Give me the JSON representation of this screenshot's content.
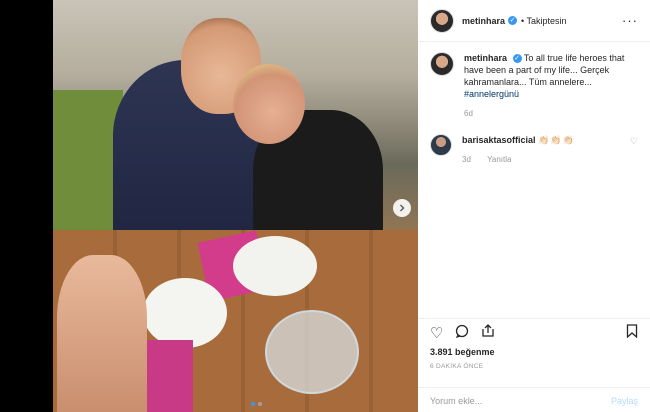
{
  "post": {
    "username": "metinhara",
    "follow_status": "• Takiptesin",
    "caption_user": "metinhara",
    "caption_text": "To all true life heroes that have been a part of my life... Gerçek kahramanlara... Tüm annelere...",
    "caption_hashtag": "#annelergünü",
    "caption_age": "6d"
  },
  "comments": [
    {
      "user": "barisaktasofficial",
      "text": "👏🏻👏🏻👏🏻",
      "age": "3d",
      "reply_label": "Yanıtla"
    }
  ],
  "actions": {
    "likes": "3.891 beğenme",
    "time": "6 DAKİKA ÖNCE",
    "add_comment_placeholder": "Yorum ekle...",
    "post_label": "Paylaş"
  },
  "icons": {
    "verified": "verified-badge-icon",
    "more": "more-options-icon",
    "like": "heart-icon",
    "comment": "comment-icon",
    "share": "share-icon",
    "save": "bookmark-icon",
    "next": "chevron-right-icon"
  },
  "colors": {
    "accent": "#3897f0",
    "muted": "#999999"
  }
}
